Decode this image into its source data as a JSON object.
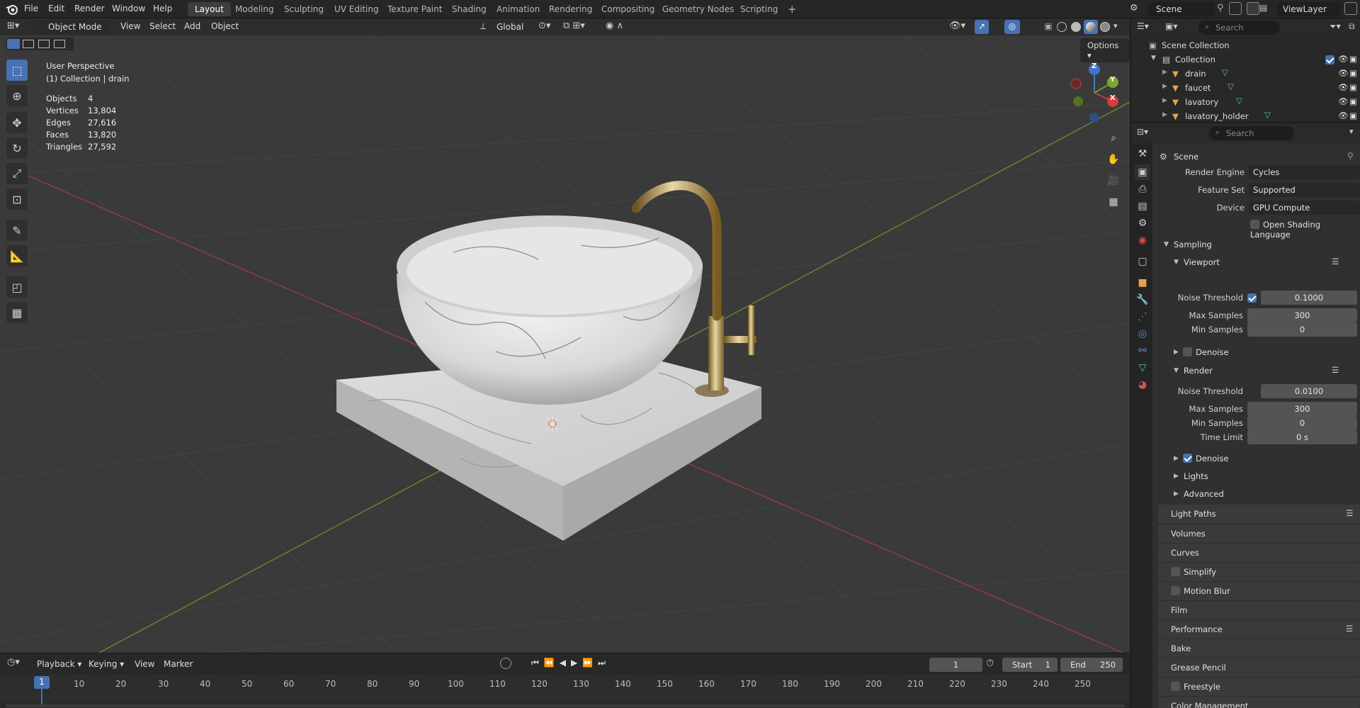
{
  "topbar": {
    "menus": [
      "File",
      "Edit",
      "Render",
      "Window",
      "Help"
    ],
    "workspaces": [
      "Layout",
      "Modeling",
      "Sculpting",
      "UV Editing",
      "Texture Paint",
      "Shading",
      "Animation",
      "Rendering",
      "Compositing",
      "Geometry Nodes",
      "Scripting"
    ],
    "add_tab": "+",
    "scene": "Scene",
    "view_layer": "ViewLayer"
  },
  "viewport": {
    "mode": "Object Mode",
    "menus": [
      "View",
      "Select",
      "Add",
      "Object"
    ],
    "orientation": "Global",
    "options": "Options",
    "perspective": "User Perspective",
    "collection_info": "(1) Collection | drain",
    "stats": [
      {
        "label": "Objects",
        "value": "4"
      },
      {
        "label": "Vertices",
        "value": "13,804"
      },
      {
        "label": "Edges",
        "value": "27,616"
      },
      {
        "label": "Faces",
        "value": "13,820"
      },
      {
        "label": "Triangles",
        "value": "27,592"
      }
    ],
    "gizmo": {
      "x": "X",
      "y": "Y",
      "z": "Z"
    }
  },
  "outliner": {
    "search_placeholder": "Search",
    "scene_collection": "Scene Collection",
    "collection": "Collection",
    "objects": [
      "drain",
      "faucet",
      "lavatory",
      "lavatory_holder"
    ]
  },
  "properties": {
    "search_placeholder": "Search",
    "context": "Scene",
    "render_engine_label": "Render Engine",
    "render_engine": "Cycles",
    "feature_set_label": "Feature Set",
    "feature_set": "Supported",
    "device_label": "Device",
    "device": "GPU Compute",
    "osl": "Open Shading Language",
    "sampling": "Sampling",
    "viewport": "Viewport",
    "noise_threshold_label": "Noise Threshold",
    "vp_noise": "0.1000",
    "max_samples_label": "Max Samples",
    "vp_max": "300",
    "min_samples_label": "Min Samples",
    "vp_min": "0",
    "denoise": "Denoise",
    "render": "Render",
    "r_noise": "0.0100",
    "r_max": "300",
    "r_min": "0",
    "time_limit_label": "Time Limit",
    "r_time": "0 s",
    "r_denoise": "Denoise",
    "lights": "Lights",
    "advanced": "Advanced",
    "sections": [
      "Light Paths",
      "Volumes",
      "Curves",
      "Simplify",
      "Motion Blur",
      "Film",
      "Performance",
      "Bake",
      "Grease Pencil",
      "Freestyle",
      "Color Management"
    ]
  },
  "timeline": {
    "menus": [
      "Playback",
      "Keying",
      "View",
      "Marker"
    ],
    "current_frame": "1",
    "start_label": "Start",
    "start": "1",
    "end_label": "End",
    "end": "250",
    "ticks": [
      "1",
      "10",
      "20",
      "30",
      "40",
      "50",
      "60",
      "70",
      "80",
      "90",
      "100",
      "110",
      "120",
      "130",
      "140",
      "150",
      "160",
      "170",
      "180",
      "190",
      "200",
      "210",
      "220",
      "230",
      "240",
      "250"
    ]
  },
  "colors": {
    "accent": "#4772b3",
    "x_axis": "#c53a3a",
    "y_axis": "#6e9a2e",
    "gold": "#b8903a"
  }
}
